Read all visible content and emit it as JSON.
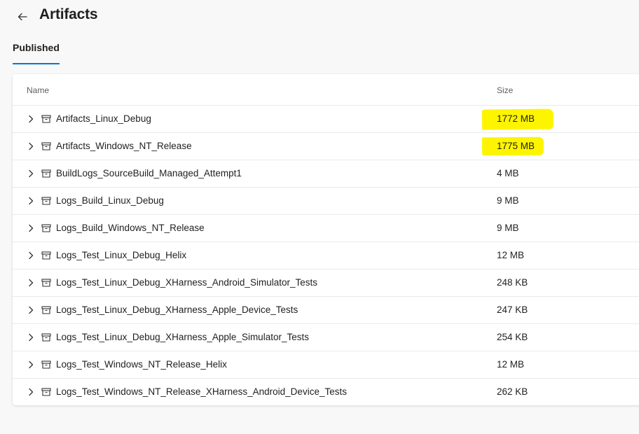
{
  "page": {
    "title": "Artifacts",
    "back_icon": "arrow-left-icon"
  },
  "tabs": [
    {
      "label": "Published",
      "selected": true
    }
  ],
  "table": {
    "columns": {
      "name": "Name",
      "size": "Size"
    },
    "rows": [
      {
        "name": "Artifacts_Linux_Debug",
        "size": "1772 MB",
        "highlighted": true
      },
      {
        "name": "Artifacts_Windows_NT_Release",
        "size": "1775 MB",
        "highlighted": true
      },
      {
        "name": "BuildLogs_SourceBuild_Managed_Attempt1",
        "size": "4 MB",
        "highlighted": false
      },
      {
        "name": "Logs_Build_Linux_Debug",
        "size": "9 MB",
        "highlighted": false
      },
      {
        "name": "Logs_Build_Windows_NT_Release",
        "size": "9 MB",
        "highlighted": false
      },
      {
        "name": "Logs_Test_Linux_Debug_Helix",
        "size": "12 MB",
        "highlighted": false
      },
      {
        "name": "Logs_Test_Linux_Debug_XHarness_Android_Simulator_Tests",
        "size": "248 KB",
        "highlighted": false
      },
      {
        "name": "Logs_Test_Linux_Debug_XHarness_Apple_Device_Tests",
        "size": "247 KB",
        "highlighted": false
      },
      {
        "name": "Logs_Test_Linux_Debug_XHarness_Apple_Simulator_Tests",
        "size": "254 KB",
        "highlighted": false
      },
      {
        "name": "Logs_Test_Windows_NT_Release_Helix",
        "size": "12 MB",
        "highlighted": false
      },
      {
        "name": "Logs_Test_Windows_NT_Release_XHarness_Android_Device_Tests",
        "size": "262 KB",
        "highlighted": false
      }
    ]
  },
  "icons": {
    "row_expand": "chevron-right-icon",
    "artifact": "artifact-box-icon"
  },
  "colors": {
    "accent": "#0078d4",
    "highlight": "#fdf500",
    "background": "#f8f8f8"
  }
}
